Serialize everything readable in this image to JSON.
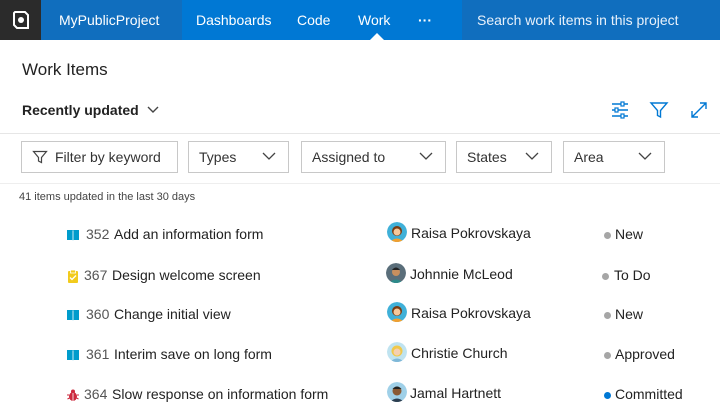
{
  "nav": {
    "project": "MyPublicProject",
    "items": [
      "Dashboards",
      "Code",
      "Work",
      "···"
    ],
    "search_placeholder": "Search work items in this project"
  },
  "header": {
    "title": "Work Items",
    "view": "Recently updated"
  },
  "filters": {
    "keyword_placeholder": "Filter by keyword",
    "types": "Types",
    "assigned_to": "Assigned to",
    "states": "States",
    "area": "Area"
  },
  "summary": "41 items updated in the last 30 days",
  "colors": {
    "topbar": "#0078d4",
    "accent": "#0078d4",
    "state_new": "#a6a6a6",
    "state_committed": "#0078d4"
  },
  "items": [
    {
      "id": "352",
      "title": "Add an information form",
      "type_icon": "book-icon",
      "assignee": "Raisa Pokrovskaya",
      "state": "New"
    },
    {
      "id": "367",
      "title": "Design welcome screen",
      "type_icon": "task-clipboard-icon",
      "assignee": "Johnnie McLeod",
      "state": "To Do"
    },
    {
      "id": "360",
      "title": "Change initial view",
      "type_icon": "book-icon",
      "assignee": "Raisa Pokrovskaya",
      "state": "New"
    },
    {
      "id": "361",
      "title": "Interim save on long form",
      "type_icon": "book-icon",
      "assignee": "Christie Church",
      "state": "Approved"
    },
    {
      "id": "364",
      "title": "Slow response on information form",
      "type_icon": "bug-icon",
      "assignee": "Jamal Hartnett",
      "state": "Committed"
    }
  ]
}
